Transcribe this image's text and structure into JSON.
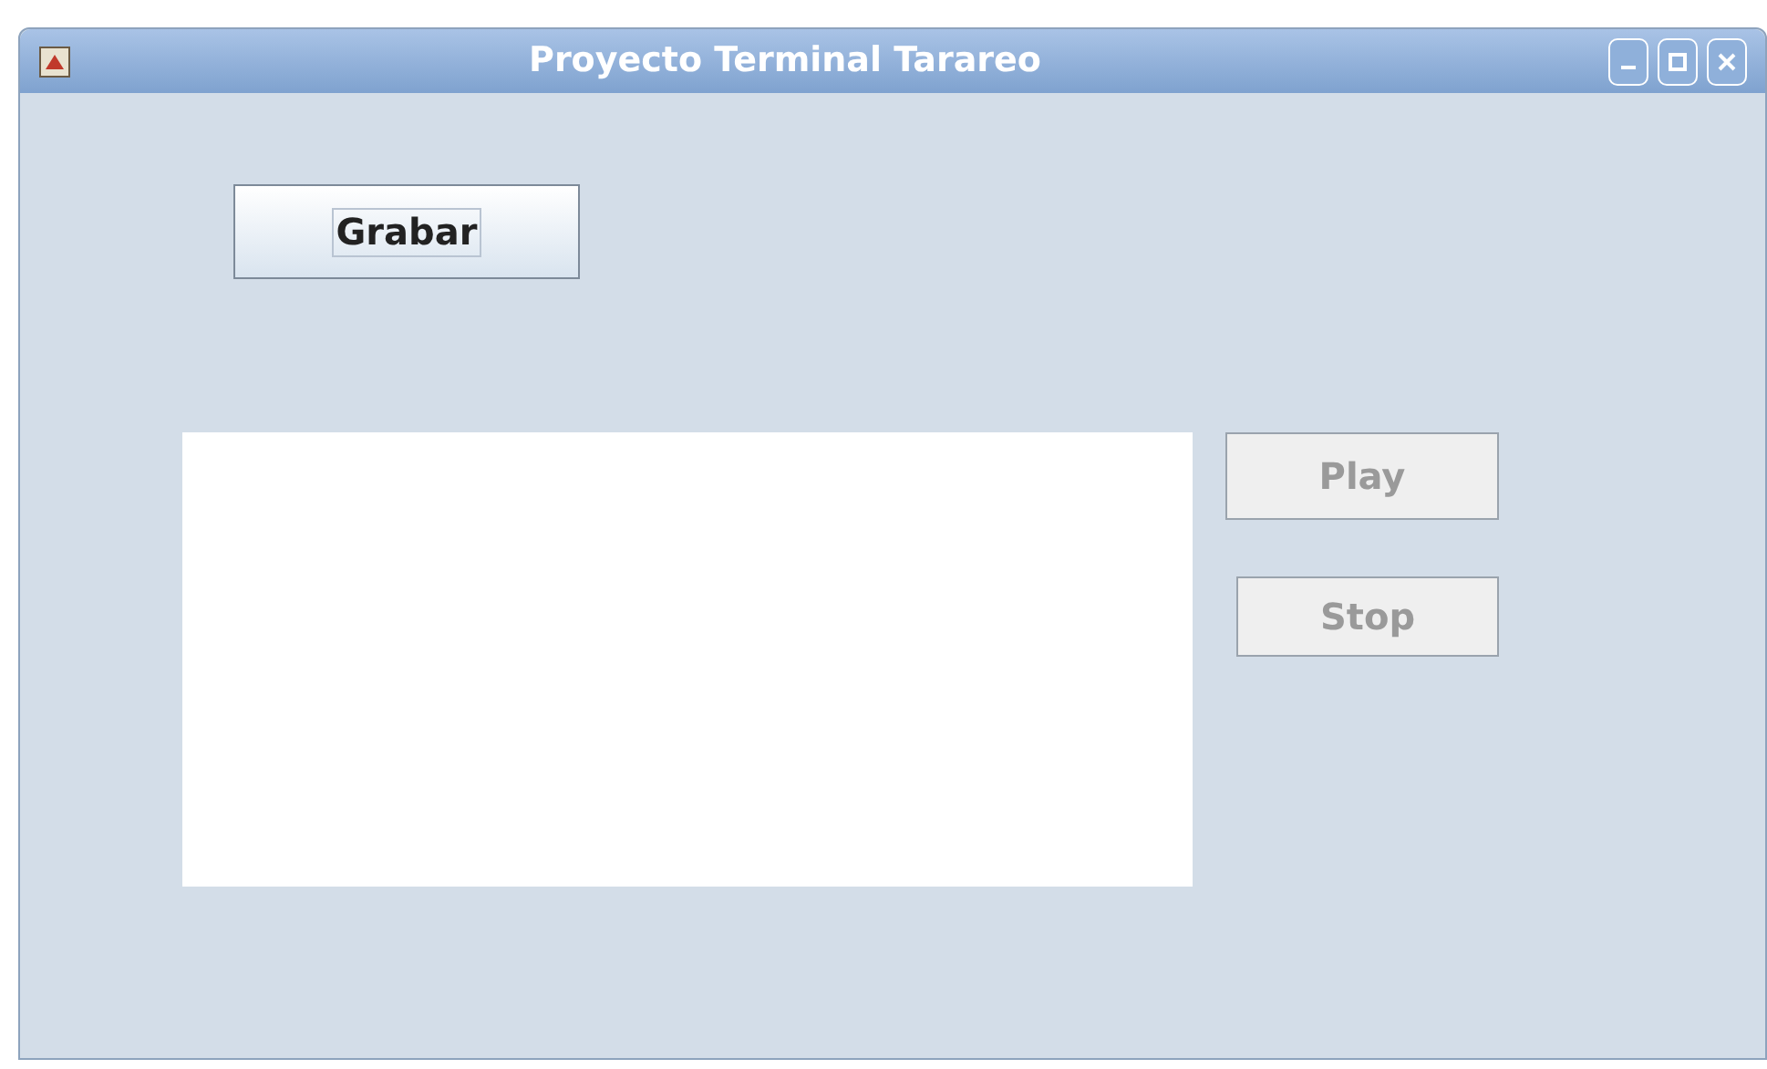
{
  "window": {
    "title": "Proyecto Terminal Tarareo"
  },
  "record_button": {
    "label": "Grabar",
    "disabled": false,
    "focused": true
  },
  "side_buttons": [
    {
      "label": "Play",
      "disabled": true
    },
    {
      "label": "Stop",
      "disabled": true
    }
  ]
}
